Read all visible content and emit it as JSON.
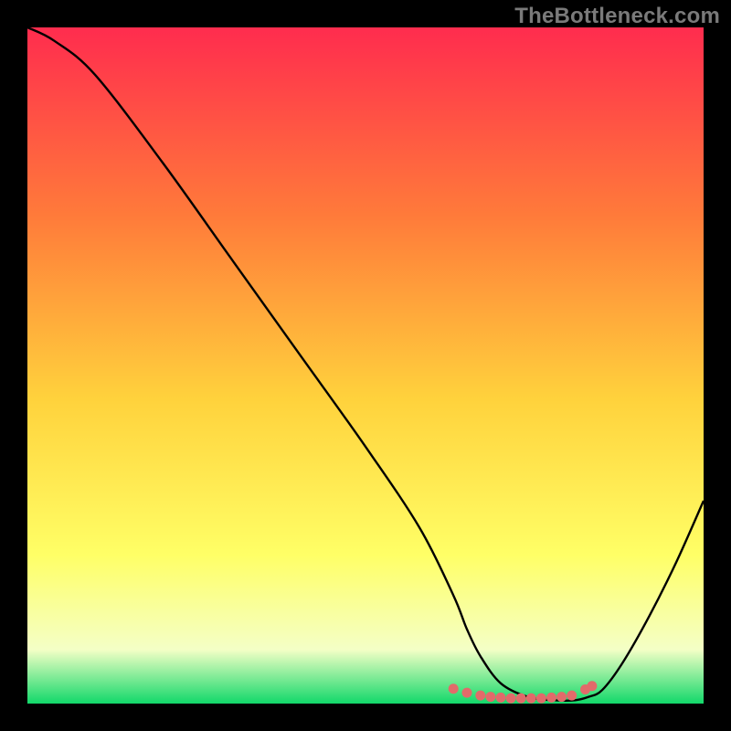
{
  "watermark": "TheBottleneck.com",
  "colors": {
    "curve": "#000000",
    "dots": "#e26a6a",
    "gradient_top": "#ff2c4e",
    "gradient_mid_top": "#ff7b3a",
    "gradient_mid": "#ffd23c",
    "gradient_mid_low": "#ffff66",
    "gradient_low": "#f4ffc6",
    "gradient_bottom": "#12d86a"
  },
  "chart_data": {
    "type": "line",
    "title": "",
    "xlabel": "",
    "ylabel": "",
    "xlim": [
      0,
      100
    ],
    "ylim": [
      0,
      100
    ],
    "series": [
      {
        "name": "bottleneck-curve",
        "x": [
          0,
          4,
          10,
          20,
          30,
          40,
          50,
          58,
          63,
          65,
          67,
          70,
          74,
          78,
          81,
          83,
          85,
          88,
          92,
          96,
          100
        ],
        "y": [
          100,
          98,
          93,
          80,
          66,
          52,
          38,
          26,
          16,
          11,
          7,
          3,
          1,
          0.5,
          0.5,
          1,
          2,
          6,
          13,
          21,
          30
        ]
      }
    ],
    "highlight_dots": {
      "name": "optimal-range",
      "x": [
        63,
        65,
        67,
        68.5,
        70,
        71.5,
        73,
        74.5,
        76,
        77.5,
        79,
        80.5,
        82.5,
        83.5
      ],
      "y": [
        2.2,
        1.6,
        1.2,
        1.0,
        0.9,
        0.8,
        0.8,
        0.8,
        0.8,
        0.9,
        1.0,
        1.2,
        2.1,
        2.6
      ]
    }
  }
}
